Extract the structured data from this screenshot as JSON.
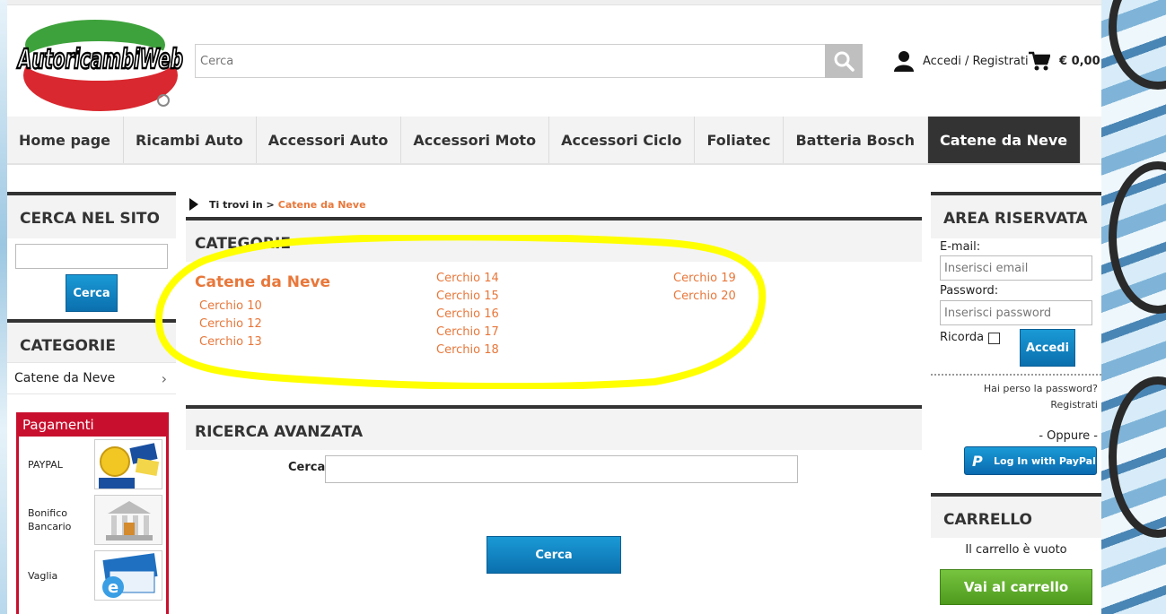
{
  "header": {
    "logo_text": "AutoricambiWeb",
    "search_placeholder": "Cerca",
    "account_label": "Accedi / Registrati",
    "cart_total": "€ 0,00"
  },
  "nav": {
    "items": [
      "Home page",
      "Ricambi Auto",
      "Accessori Auto",
      "Accessori Moto",
      "Accessori Ciclo",
      "Foliatec",
      "Batteria Bosch",
      "Catene da Neve"
    ],
    "active": "Catene da Neve"
  },
  "left": {
    "search_title": "CERCA NEL SITO",
    "search_button": "Cerca",
    "categories_title": "CATEGORIE",
    "category_item": "Catene da Neve",
    "payments_title": "Pagamenti",
    "payments": [
      {
        "label": "PAYPAL"
      },
      {
        "label": "Bonifico Bancario"
      },
      {
        "label": "Vaglia"
      }
    ]
  },
  "center": {
    "breadcrumb_prefix": "Ti trovi in >",
    "breadcrumb_current": "Catene da Neve",
    "categories_title": "CATEGORIE",
    "main_category": "Catene da Neve",
    "col1": [
      "Cerchio 10",
      "Cerchio 12",
      "Cerchio 13"
    ],
    "col2": [
      "Cerchio 14",
      "Cerchio 15",
      "Cerchio 16",
      "Cerchio 17",
      "Cerchio 18"
    ],
    "col3": [
      "Cerchio 19",
      "Cerchio 20"
    ],
    "advanced_title": "RICERCA AVANZATA",
    "advanced_label": "Cerca",
    "advanced_button": "Cerca"
  },
  "right": {
    "area_title": "AREA RISERVATA",
    "email_label": "E-mail:",
    "email_placeholder": "Inserisci email",
    "password_label": "Password:",
    "password_placeholder": "Inserisci password",
    "remember_label": "Ricorda",
    "login_button": "Accedi",
    "forgot_link": "Hai perso la password?",
    "register_link": "Registrati",
    "or_text": "- Oppure -",
    "paypal_button": "Log In with PayPal",
    "cart_title": "CARRELLO",
    "cart_empty": "Il carrello è vuoto",
    "cart_button": "Vai al carrello"
  },
  "colors": {
    "accent_orange": "#e8773a",
    "dark": "#333333",
    "blue": "#0b6fae",
    "green": "#4e9a1e",
    "highlight": "#ffff00"
  }
}
